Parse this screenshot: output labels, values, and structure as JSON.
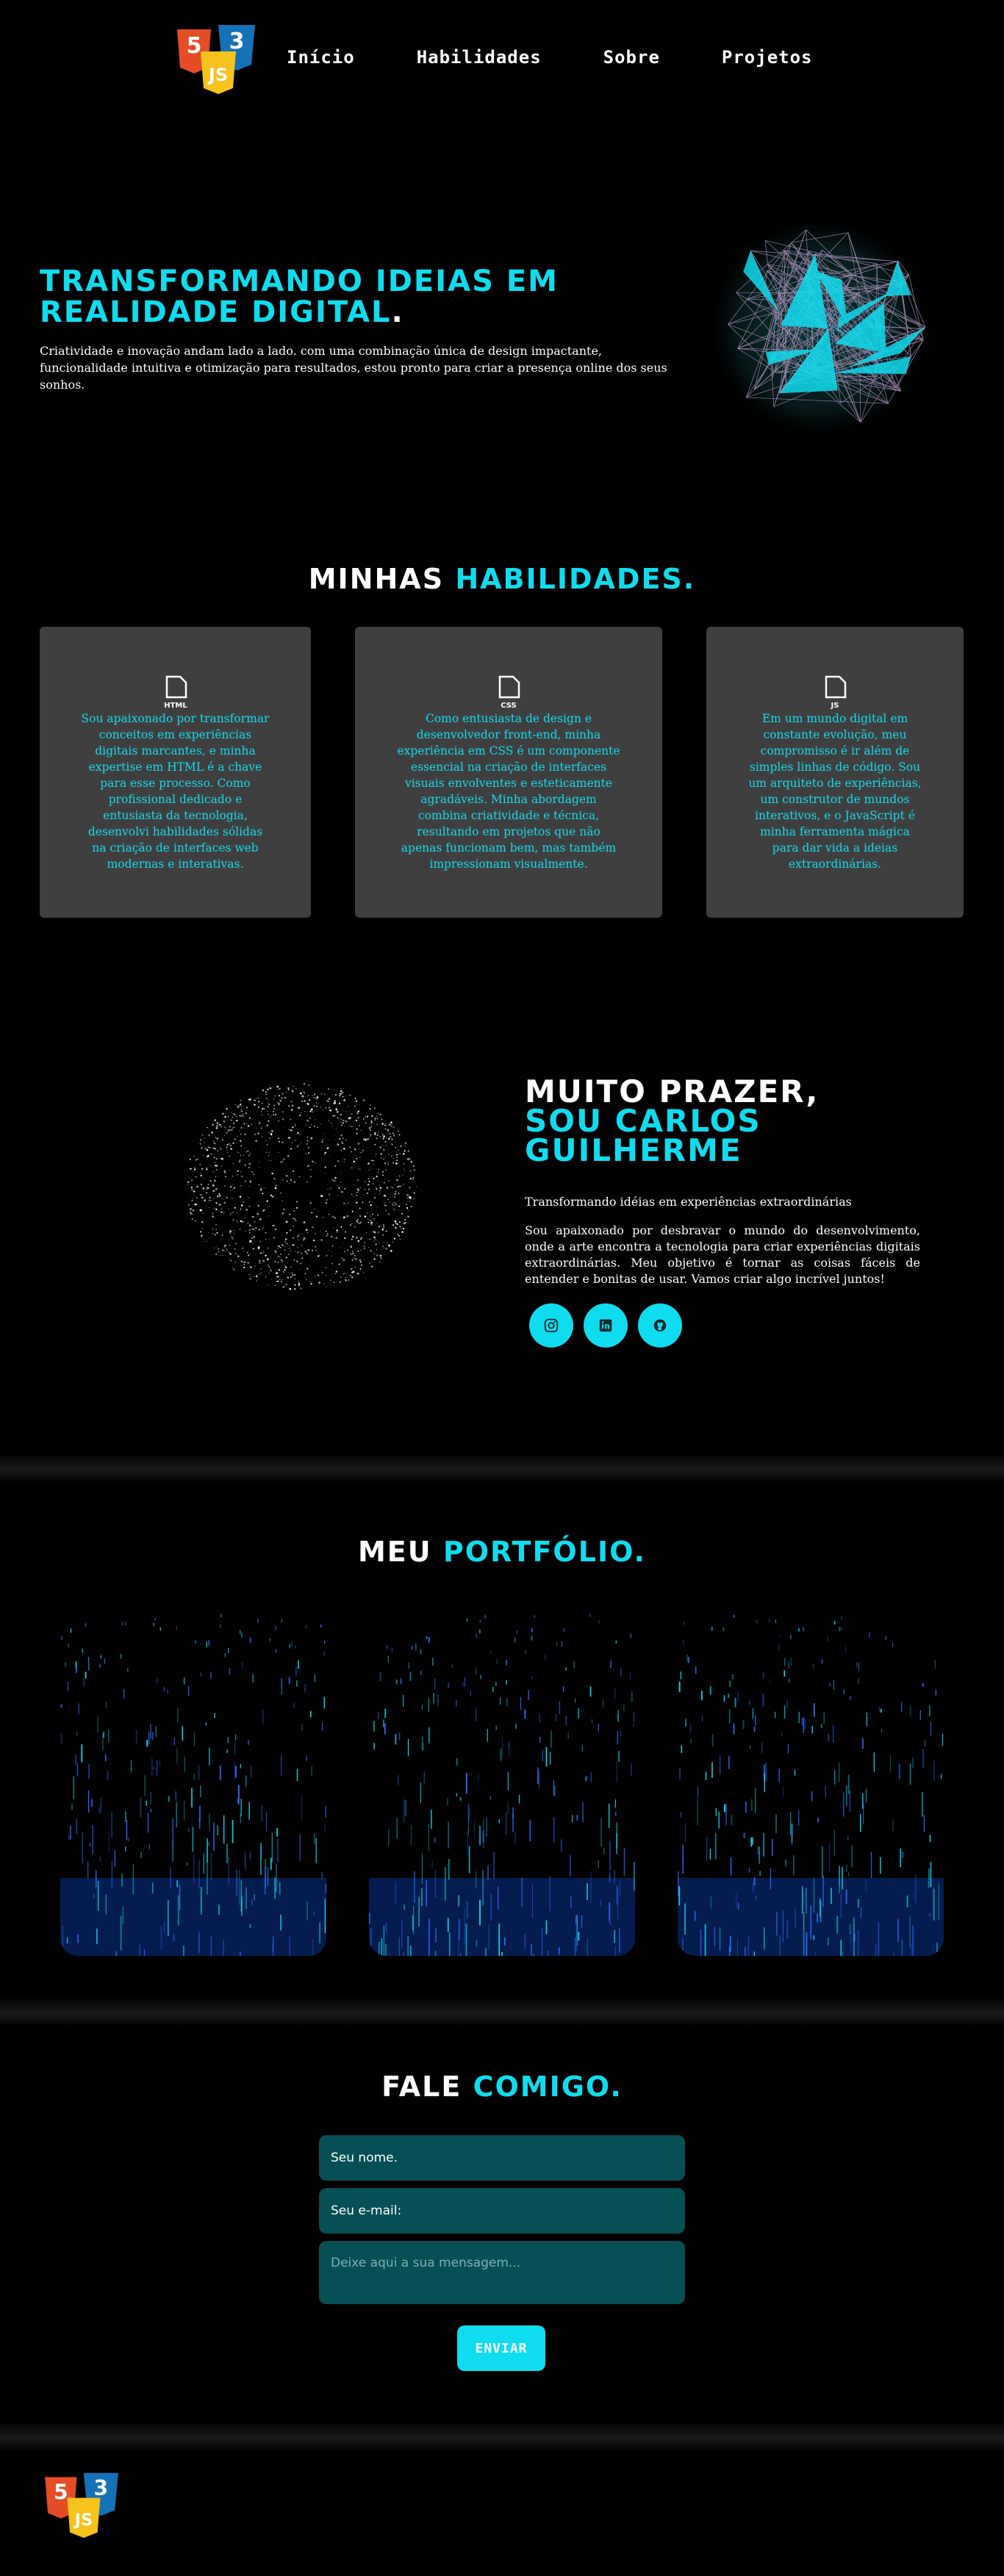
{
  "header": {
    "logo_alt": "HTML5 CSS3 JS logo",
    "nav": [
      {
        "label": "Início"
      },
      {
        "label": "Habilidades"
      },
      {
        "label": "Sobre"
      },
      {
        "label": "Projetos"
      }
    ]
  },
  "hero": {
    "title_line1": "TRANSFORMANDO IDEIAS EM",
    "title_line2": "REALIDADE DIGITAL",
    "title_dot": ".",
    "text": "Criatividade e inovação andam lado a lado. com uma combinação única de design impactante, funcionalidade intuitiva e otimização para resultados, estou pronto para criar a presença online dos seus sonhos."
  },
  "skills": {
    "title_plain": "MINHAS ",
    "title_accent": "HABILIDADES.",
    "cards": [
      {
        "icon": "html-file-icon",
        "icon_label": "HTML",
        "text": "Sou apaixonado por transformar conceitos em experiências digitais marcantes, e minha expertise em HTML é a chave para esse processo. Como profissional dedicado e entusiasta da tecnologia, desenvolvi habilidades sólidas na criação de interfaces web modernas e interativas."
      },
      {
        "icon": "css-file-icon",
        "icon_label": "CSS",
        "text": "Como entusiasta de design e desenvolvedor front-end, minha experiência em CSS é um componente essencial na criação de interfaces visuais envolventes e esteticamente agradáveis. Minha abordagem combina criatividade e técnica, resultando em projetos que não apenas funcionam bem, mas também impressionam visualmente."
      },
      {
        "icon": "js-file-icon",
        "icon_label": "JS",
        "text": "Em um mundo digital em constante evolução, meu compromisso é ir além de simples linhas de código. Sou um arquiteto de experiências, um construtor de mundos interativos, e o JavaScript é minha ferramenta mágica para dar vida a ideias extraordinárias."
      }
    ]
  },
  "about": {
    "title_line1": "MUITO PRAZER,",
    "title_line2": "SOU CARLOS",
    "title_line3": "GUILHERME",
    "subtitle": "Transformando idéias em experiências extraordinárias",
    "text": "Sou apaixonado por desbravar o mundo do desenvolvimento, onde a arte encontra a tecnologia para criar experiências digitais extraordinárias. Meu objetivo é tornar as coisas fáceis de entender e bonitas de usar. Vamos criar algo incrível juntos!",
    "social": [
      {
        "name": "instagram-icon"
      },
      {
        "name": "linkedin-icon"
      },
      {
        "name": "github-icon"
      }
    ]
  },
  "portfolio": {
    "title_plain": "MEU ",
    "title_accent": "PORTFÓLIO."
  },
  "contact": {
    "title_plain": "FALE ",
    "title_accent": "COMIGO.",
    "name_placeholder": "Seu nome.",
    "email_placeholder": "Seu e-mail:",
    "message_placeholder": "Deixe aqui a sua mensagem...",
    "send_label": "ENVIAR"
  },
  "colors": {
    "accent": "#10dcef",
    "card_bg": "#3f3f3f",
    "field_bg": "#064f55"
  }
}
